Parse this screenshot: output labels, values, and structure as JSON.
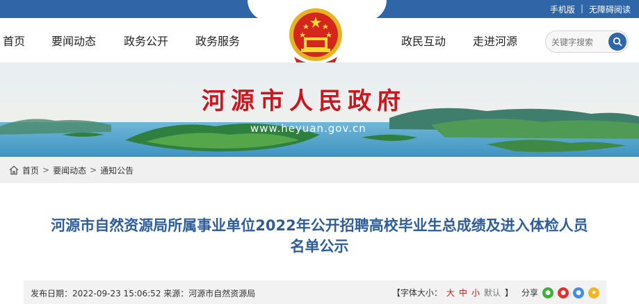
{
  "toplinks": {
    "mobile": "手机版",
    "separator": "|",
    "accessible": "无障碍阅读"
  },
  "nav": {
    "items": [
      "首页",
      "要闻动态",
      "政务公开",
      "政务服务",
      "政民互动",
      "走进河源"
    ]
  },
  "search": {
    "placeholder": "关键字搜索"
  },
  "banner": {
    "title": "河源市人民政府",
    "url": "www.heyuan.gov.cn"
  },
  "breadcrumb": {
    "items": [
      "首页",
      "要闻动态",
      "通知公告"
    ]
  },
  "article": {
    "title_line1": "河源市自然资源局所属事业单位2022年公开招聘高校毕业生总成绩及进入体检人员",
    "title_line2": "名单公示"
  },
  "meta": {
    "publish": "发布日期：2022-09-23 15:06:52 来源：河源市自然资源局",
    "font_size_label": "【字体大小：",
    "size_large": "大",
    "size_medium": "中",
    "size_small": "小",
    "size_default": "默认",
    "bracket_close": "】",
    "share_label": "分享"
  },
  "colors": {
    "brand_blue": "#2f66a8",
    "title_blue": "#2f5d9a",
    "red": "#c9171e"
  }
}
